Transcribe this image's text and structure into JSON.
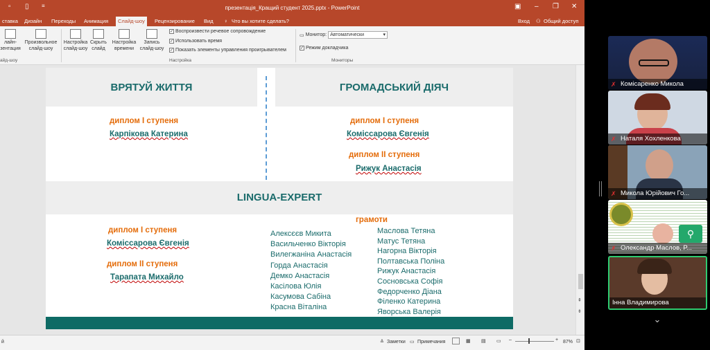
{
  "window": {
    "title": "презентація_Кращий студент 2025.pptx - PowerPoint",
    "restore_icon": "restore-icon"
  },
  "tabs": [
    "Вставка",
    "Дизайн",
    "Переходы",
    "Анимация",
    "Слайд-шоу",
    "Рецензирование",
    "Вид"
  ],
  "tabs_display": [
    "ставка",
    "Дизайн",
    "Переходы",
    "Анимация",
    "Слайд-шоу",
    "Рецензирование",
    "Вид"
  ],
  "tell_me": "Что вы хотите сделать?",
  "login": "Вход",
  "share": "Общий доступ",
  "ribbon": {
    "btn_online": [
      "Онлайн-",
      "презентация"
    ],
    "btn_online_display": [
      "лайн-",
      "зентация"
    ],
    "btn_custom": [
      "Произвольное",
      "слайд-шоу"
    ],
    "btn_setup": [
      "Настройка",
      "слайд-шоу"
    ],
    "btn_hide": [
      "Скрыть",
      "слайд"
    ],
    "btn_timing": [
      "Настройка",
      "времени"
    ],
    "btn_record": [
      "Запись",
      "слайд-шоу"
    ],
    "chk_narration": "Воспроизвести речевое сопровождение",
    "chk_timings": "Использовать время",
    "chk_controls": "Показать элементы управления проигрывателем",
    "monitor_label": "Монитор:",
    "monitor_value": "Автоматически",
    "presenter_view": "Режим докладчика",
    "group_start": "айд-шоу",
    "group_setup": "Настройка",
    "group_monitors": "Мониторы"
  },
  "slide": {
    "col1_title": "ВРЯТУЙ ЖИТТЯ",
    "col2_title": "ГРОМАДСЬКИЙ ДІЯЧ",
    "s1_dip1": "диплом І ступеня",
    "s1_name1": "Карпікова Катерина",
    "s2_dip1": "диплом І ступеня",
    "s2_name1": "Коміссарова Євгенія",
    "s2_dip2": "диплом ІІ ступеня",
    "s2_name2": "Рижук Анастасія",
    "lingua_title": "LINGUA-EXPERT",
    "l_dip1": "диплом І ступеня",
    "l_name1": "Коміссарова Євгенія",
    "l_dip2": "диплом ІІ ступеня",
    "l_name2": "Тарапата Михайло",
    "gramoty": "грамоти",
    "list_left": [
      "Алексєєв Микита",
      "Васильченко Вікторія",
      "Вилегжаніна Анастасія",
      "Горда Анастасія",
      "Демко Анастасія",
      "Касілова Юлія",
      "Касумова Сабіна",
      "Красна Віталіна"
    ],
    "list_right": [
      "Маслова Тетяна",
      "Матус Тетяна",
      "Нагорна Вікторія",
      "Полтавська Поліна",
      "Рижук Анастасія",
      "Сосновська Софія",
      "Федорченко Діана",
      "Філенко Катерина",
      "Яворська Валерія"
    ]
  },
  "status": {
    "left": "й",
    "notes": "Заметки",
    "comments": "Примечания",
    "zoom": "87%"
  },
  "participants": [
    {
      "name": "Комісаренко Микола",
      "muted": true
    },
    {
      "name": "Наталя Хохленкова",
      "muted": true
    },
    {
      "name": "Микола Юрійович Го...",
      "muted": true
    },
    {
      "name": "Олександр Маслов, Р...",
      "muted": true
    },
    {
      "name": "Інна Владимирова",
      "muted": false
    }
  ],
  "colors": {
    "ppt_accent": "#b7472a",
    "heading_teal": "#1a6b6b",
    "diploma_orange": "#e46c0a",
    "active_speaker": "#2ecc71"
  }
}
